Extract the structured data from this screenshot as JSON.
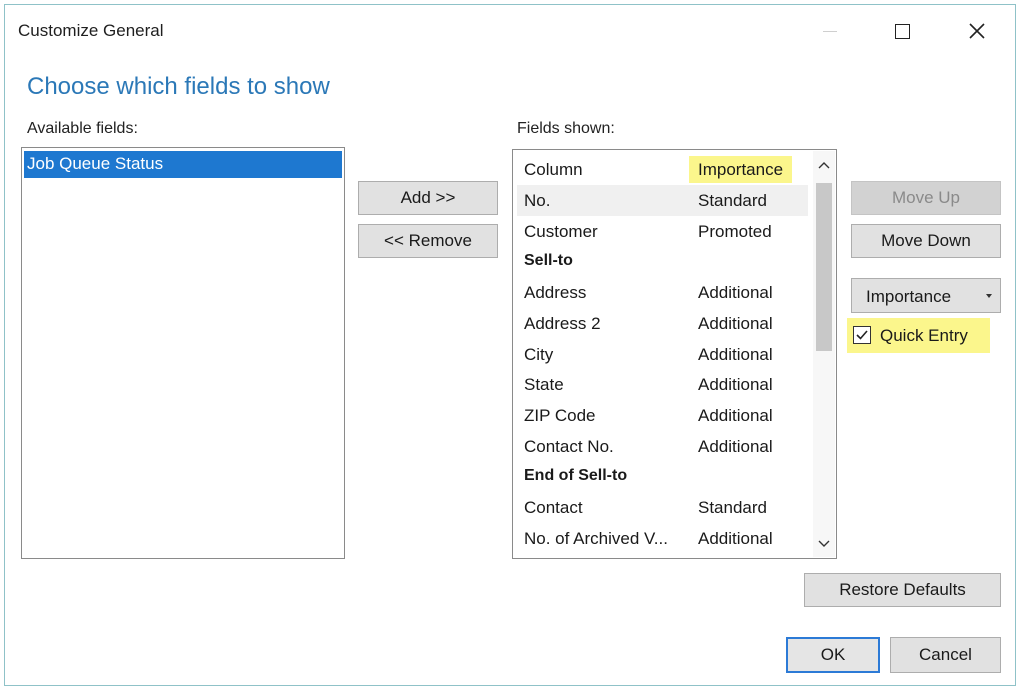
{
  "window": {
    "title": "Customize General",
    "minimize_icon": "minimize-icon",
    "maximize_icon": "maximize-icon",
    "close_icon": "close-icon"
  },
  "heading": "Choose which fields to show",
  "available": {
    "label": "Available fields:",
    "items": [
      "Job Queue Status"
    ]
  },
  "shown": {
    "label": "Fields shown:",
    "header": {
      "column": "Column",
      "importance": "Importance"
    },
    "rows": [
      {
        "column": "No.",
        "importance": "Standard"
      },
      {
        "column": "Customer",
        "importance": "Promoted"
      },
      {
        "column": "Sell-to",
        "importance": ""
      },
      {
        "column": "Address",
        "importance": "Additional"
      },
      {
        "column": "Address 2",
        "importance": "Additional"
      },
      {
        "column": "City",
        "importance": "Additional"
      },
      {
        "column": "State",
        "importance": "Additional"
      },
      {
        "column": "ZIP Code",
        "importance": "Additional"
      },
      {
        "column": "Contact No.",
        "importance": "Additional"
      },
      {
        "column": "End of Sell-to",
        "importance": ""
      },
      {
        "column": "Contact",
        "importance": "Standard"
      },
      {
        "column": "No. of Archived V...",
        "importance": "Additional"
      }
    ]
  },
  "buttons": {
    "add": "Add >>",
    "remove": "<< Remove",
    "move_up": "Move Up",
    "move_down": "Move Down",
    "restore_defaults": "Restore Defaults",
    "ok": "OK",
    "cancel": "Cancel"
  },
  "importance_select": {
    "value": "Importance"
  },
  "quick_entry": {
    "label": "Quick Entry",
    "checked": true
  },
  "colors": {
    "accent": "#2b78b7",
    "selection": "#1e78d0",
    "highlight": "#fbf68c",
    "default_button_border": "#2c7ad6"
  }
}
